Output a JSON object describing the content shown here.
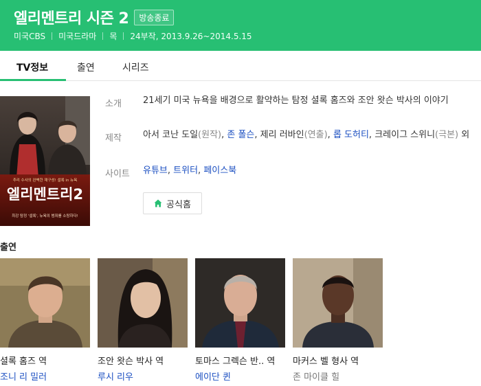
{
  "header": {
    "title": "엘리멘트리 시즌 2",
    "status_badge": "방송종료",
    "meta": [
      "미국CBS",
      "미국드라마",
      "목",
      "24부작, 2013.9.26~2014.5.15"
    ]
  },
  "tabs": [
    {
      "label": "TV정보",
      "active": true
    },
    {
      "label": "출연",
      "active": false
    },
    {
      "label": "시리즈",
      "active": false
    }
  ],
  "poster": {
    "tagline": "추리 수사의 완벽한 재구성! 셜록 in 뉴욕",
    "logo_text": "엘리멘트리2",
    "bottom_text": "최강 탐정 '셜록', 뉴욕의 범죄를 소탕하다!"
  },
  "info": {
    "intro_label": "소개",
    "intro_text": "21세기 미국 뉴욕을 배경으로 활약하는 탐정 셜록 홈즈와 조안 왓슨 박사의 이야기",
    "production_label": "제작",
    "production": {
      "p1": "아서 코난 도일",
      "p1_role": "(원작)",
      "p2": "존 폴슨",
      "p3_name": "제리 러바인",
      "p3_role": "(연출)",
      "p4": "롭 도허티",
      "p5_name": "크레이그 스위니",
      "p5_role": "(극본)",
      "suffix": "외"
    },
    "site_label": "사이트",
    "sites": [
      "유튜브",
      "트위터",
      "페이스북"
    ]
  },
  "home_button": {
    "label": "공식홈",
    "icon": "home-icon"
  },
  "cast_section_title": "출연",
  "cast": [
    {
      "role": "셜록 홈즈 역",
      "actor": "조니 리 밀러",
      "linked": true
    },
    {
      "role": "조안 왓슨 박사 역",
      "actor": "루시 리우",
      "linked": true
    },
    {
      "role": "토마스 그렉슨 반.. 역",
      "actor": "에이단 퀸",
      "linked": true
    },
    {
      "role": "마커스 벨 형사 역",
      "actor": "존 마이클 힐",
      "linked": false
    }
  ],
  "colors": {
    "brand_green": "#27bf73",
    "link_blue": "#1a4ec1"
  }
}
